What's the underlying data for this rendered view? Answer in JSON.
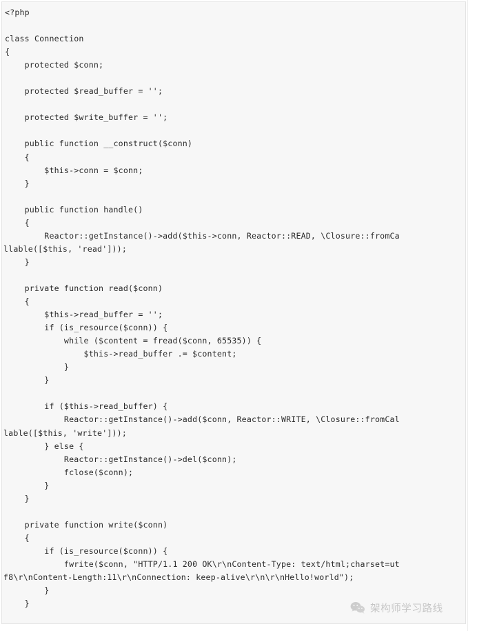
{
  "document": {
    "type": "code-snippet",
    "language": "php",
    "background_color": "#f7f7f7",
    "text_color": "#2b2b2b",
    "border_color": "#e3e3e3"
  },
  "code": {
    "lines": [
      {
        "text": "<?php",
        "wrapped": false
      },
      {
        "text": "",
        "wrapped": false
      },
      {
        "text": "class Connection",
        "wrapped": false
      },
      {
        "text": "{",
        "wrapped": false
      },
      {
        "text": "    protected $conn;",
        "wrapped": false
      },
      {
        "text": "",
        "wrapped": false
      },
      {
        "text": "    protected $read_buffer = '';",
        "wrapped": false
      },
      {
        "text": "",
        "wrapped": false
      },
      {
        "text": "    protected $write_buffer = '';",
        "wrapped": false
      },
      {
        "text": "",
        "wrapped": false
      },
      {
        "text": "    public function __construct($conn)",
        "wrapped": false
      },
      {
        "text": "    {",
        "wrapped": false
      },
      {
        "text": "        $this->conn = $conn;",
        "wrapped": false
      },
      {
        "text": "    }",
        "wrapped": false
      },
      {
        "text": "",
        "wrapped": false
      },
      {
        "text": "    public function handle()",
        "wrapped": false
      },
      {
        "text": "    {",
        "wrapped": false
      },
      {
        "text": "        Reactor::getInstance()->add($this->conn, Reactor::READ, \\Closure::fromCa",
        "wrapped": false
      },
      {
        "text": "llable([$this, 'read']));",
        "wrapped": true
      },
      {
        "text": "    }",
        "wrapped": false
      },
      {
        "text": "",
        "wrapped": false
      },
      {
        "text": "    private function read($conn)",
        "wrapped": false
      },
      {
        "text": "    {",
        "wrapped": false
      },
      {
        "text": "        $this->read_buffer = '';",
        "wrapped": false
      },
      {
        "text": "        if (is_resource($conn)) {",
        "wrapped": false
      },
      {
        "text": "            while ($content = fread($conn, 65535)) {",
        "wrapped": false
      },
      {
        "text": "                $this->read_buffer .= $content;",
        "wrapped": false
      },
      {
        "text": "            }",
        "wrapped": false
      },
      {
        "text": "        }",
        "wrapped": false
      },
      {
        "text": "",
        "wrapped": false
      },
      {
        "text": "        if ($this->read_buffer) {",
        "wrapped": false
      },
      {
        "text": "            Reactor::getInstance()->add($conn, Reactor::WRITE, \\Closure::fromCal",
        "wrapped": false
      },
      {
        "text": "lable([$this, 'write']));",
        "wrapped": true
      },
      {
        "text": "        } else {",
        "wrapped": false
      },
      {
        "text": "            Reactor::getInstance()->del($conn);",
        "wrapped": false
      },
      {
        "text": "            fclose($conn);",
        "wrapped": false
      },
      {
        "text": "        }",
        "wrapped": false
      },
      {
        "text": "    }",
        "wrapped": false
      },
      {
        "text": "",
        "wrapped": false
      },
      {
        "text": "    private function write($conn)",
        "wrapped": false
      },
      {
        "text": "    {",
        "wrapped": false
      },
      {
        "text": "        if (is_resource($conn)) {",
        "wrapped": false
      },
      {
        "text": "            fwrite($conn, \"HTTP/1.1 200 OK\\r\\nContent-Type: text/html;charset=ut",
        "wrapped": false
      },
      {
        "text": "f8\\r\\nContent-Length:11\\r\\nConnection: keep-alive\\r\\n\\r\\nHello!world\");",
        "wrapped": true
      },
      {
        "text": "        }",
        "wrapped": false
      },
      {
        "text": "    }",
        "wrapped": false
      },
      {
        "text": "",
        "wrapped": false
      },
      {
        "text": "}",
        "wrapped": false
      }
    ]
  },
  "watermark": {
    "icon": "wechat-logo-icon",
    "text": "架构师学习路线"
  }
}
